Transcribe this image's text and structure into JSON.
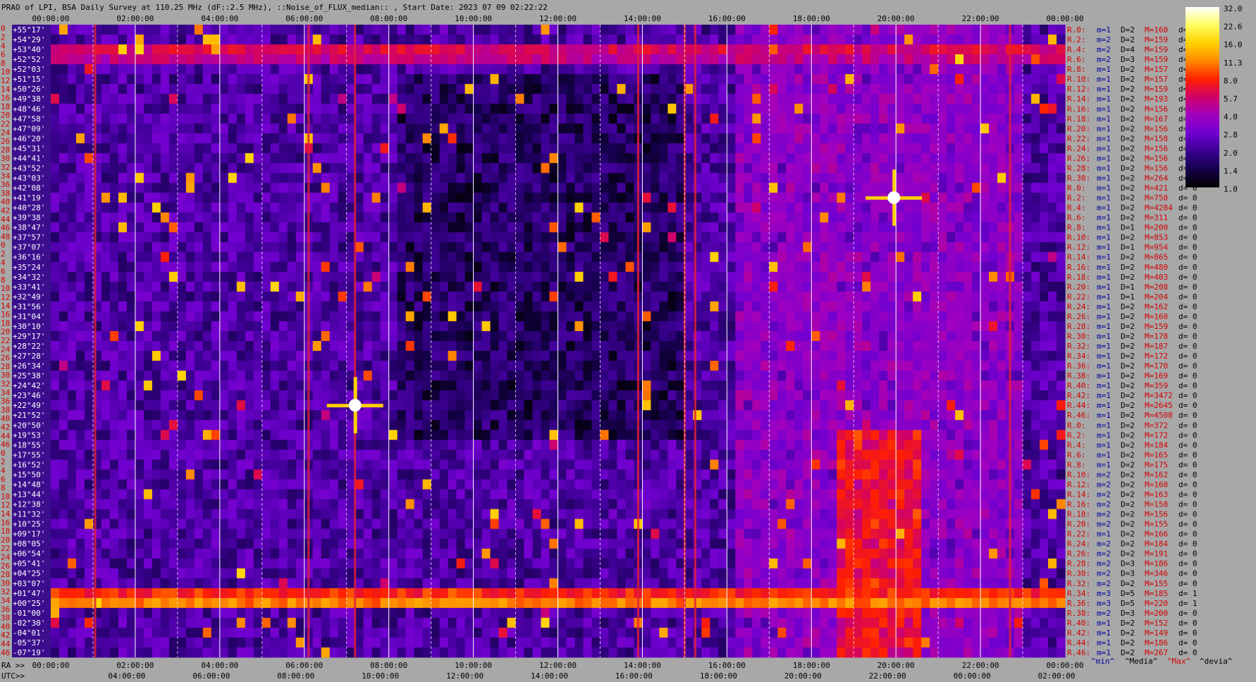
{
  "title": "PRAO of LPI, BSA Daily Survey at 110.25 MHz (dF::2.5 MHz), ::Noise_of_FLUX_median:: , Start Date: 2023 07 09 02:22:22",
  "top_time_labels": [
    "00:00:00",
    "02:00:00",
    "04:00:00",
    "06:00:00",
    "08:00:00",
    "10:00:00",
    "12:00:00",
    "14:00:00",
    "16:00:00",
    "18:00:00",
    "20:00:00",
    "22:00:00",
    "00:00:00"
  ],
  "bottom": {
    "ra_prefix": "RA >>",
    "utc_prefix": "UTC>>",
    "ra_labels": [
      "00:00:00",
      "02:00:00",
      "04:00:00",
      "06:00:00",
      "08:00:00",
      "10:00:00",
      "12:00:00",
      "14:00:00",
      "16:00:00",
      "18:00:00",
      "20:00:00",
      "22:00:00",
      "00:00:00"
    ],
    "utc_labels": [
      "04:00:00",
      "06:00:00",
      "08:00:00",
      "10:00:00",
      "12:00:00",
      "14:00:00",
      "16:00:00",
      "18:00:00",
      "20:00:00",
      "22:00:00",
      "00:00:00",
      "02:00:00"
    ]
  },
  "declinations": [
    "+55°17'",
    "+54°29'",
    "+53°40'",
    "+52°52'",
    "+52°03'",
    "+51°15'",
    "+50°26'",
    "+49°38'",
    "+48°46'",
    "+47°58'",
    "+47°09'",
    "+46°20'",
    "+45°31'",
    "+44°41'",
    "+43°52'",
    "+43°03'",
    "+42°08'",
    "+41°19'",
    "+40°28'",
    "+39°38'",
    "+38°47'",
    "+37°57'",
    "+37°07'",
    "+36°16'",
    "+35°24'",
    "+34°32'",
    "+33°41'",
    "+32°49'",
    "+31°56'",
    "+31°04'",
    "+30°10'",
    "+29°17'",
    "+28°22'",
    "+27°28'",
    "+26°34'",
    "+25°38'",
    "+24°42'",
    "+23°46'",
    "+22°49'",
    "+21°52'",
    "+20°50'",
    "+19°53'",
    "+18°55'",
    "+17°55'",
    "+16°52'",
    "+15°50'",
    "+14°48'",
    "+13°44'",
    "+12°38'",
    "+11°32'",
    "+10°25'",
    "+09°17'",
    "+08°05'",
    "+06°54'",
    "+05°41'",
    "+04°25'",
    "+03°07'",
    "+01°47'",
    "+00°25'",
    "-01°00'",
    "-02°30'",
    "-04°01'",
    "-05°37'",
    "-07°19'"
  ],
  "row_numbers": [
    "0",
    "2",
    "4",
    "6",
    "8",
    "10",
    "12",
    "14",
    "16",
    "18",
    "20",
    "22",
    "24",
    "26",
    "28",
    "30",
    "32",
    "34",
    "36",
    "38",
    "40",
    "42",
    "44",
    "46",
    "48",
    "0",
    "2",
    "4",
    "6",
    "8",
    "10",
    "12",
    "14",
    "16",
    "18",
    "20",
    "22",
    "24",
    "26",
    "28",
    "30",
    "32",
    "34",
    "36",
    "38",
    "40",
    "42",
    "44",
    "46",
    "0",
    "2",
    "4",
    "6",
    "8",
    "10",
    "12",
    "14",
    "16",
    "18",
    "20",
    "22",
    "24",
    "26",
    "28",
    "30",
    "32",
    "34",
    "36",
    "38",
    "40",
    "42",
    "44",
    "46"
  ],
  "stats": [
    {
      "r": "R.0:",
      "m": "m=1",
      "D": "D=2",
      "M": "M=160",
      "d": "d= 0"
    },
    {
      "r": "R.2:",
      "m": "m=2",
      "D": "D=2",
      "M": "M=159",
      "d": "d= 0"
    },
    {
      "r": "R.4:",
      "m": "m=2",
      "D": "D=4",
      "M": "M=159",
      "d": "d= 0"
    },
    {
      "r": "R.6:",
      "m": "m=2",
      "D": "D=3",
      "M": "M=159",
      "d": "d= 0"
    },
    {
      "r": "R.8:",
      "m": "m=1",
      "D": "D=2",
      "M": "M=157",
      "d": "d= 0"
    },
    {
      "r": "R.10:",
      "m": "m=1",
      "D": "D=2",
      "M": "M=157",
      "d": "d="
    },
    {
      "r": "R.12:",
      "m": "m=1",
      "D": "D=2",
      "M": "M=159",
      "d": "d="
    },
    {
      "r": "R.14:",
      "m": "m=1",
      "D": "D=2",
      "M": "M=193",
      "d": "d="
    },
    {
      "r": "R.16:",
      "m": "m=1",
      "D": "D=2",
      "M": "M=156",
      "d": "d="
    },
    {
      "r": "R.18:",
      "m": "m=1",
      "D": "D=2",
      "M": "M=167",
      "d": "d="
    },
    {
      "r": "R.20:",
      "m": "m=1",
      "D": "D=2",
      "M": "M=156",
      "d": "d="
    },
    {
      "r": "R.22:",
      "m": "m=1",
      "D": "D=2",
      "M": "M=158",
      "d": "d="
    },
    {
      "r": "R.24:",
      "m": "m=1",
      "D": "D=2",
      "M": "M=156",
      "d": "d="
    },
    {
      "r": "R.26:",
      "m": "m=1",
      "D": "D=2",
      "M": "M=156",
      "d": "d="
    },
    {
      "r": "R.28:",
      "m": "m=1",
      "D": "D=2",
      "M": "M=156",
      "d": "d="
    },
    {
      "r": "R.30:",
      "m": "m=1",
      "D": "D=2",
      "M": "M=264",
      "d": "d="
    },
    {
      "r": "R.0:",
      "m": "m=1",
      "D": "D=2",
      "M": "M=421",
      "d": "d= 0"
    },
    {
      "r": "R.2:",
      "m": "m=1",
      "D": "D=2",
      "M": "M=750",
      "d": "d= 0"
    },
    {
      "r": "R.4:",
      "m": "m=1",
      "D": "D=2",
      "M": "M=4284",
      "d": "d= 0"
    },
    {
      "r": "R.6:",
      "m": "m=1",
      "D": "D=2",
      "M": "M=311",
      "d": "d= 0"
    },
    {
      "r": "R.8:",
      "m": "m=1",
      "D": "D=1",
      "M": "M=200",
      "d": "d= 0"
    },
    {
      "r": "R.10:",
      "m": "m=1",
      "D": "D=2",
      "M": "M=853",
      "d": "d= 0"
    },
    {
      "r": "R.12:",
      "m": "m=1",
      "D": "D=1",
      "M": "M=954",
      "d": "d= 0"
    },
    {
      "r": "R.14:",
      "m": "m=1",
      "D": "D=2",
      "M": "M=865",
      "d": "d= 0"
    },
    {
      "r": "R.16:",
      "m": "m=1",
      "D": "D=2",
      "M": "M=480",
      "d": "d= 0"
    },
    {
      "r": "R.18:",
      "m": "m=1",
      "D": "D=2",
      "M": "M=403",
      "d": "d= 0"
    },
    {
      "r": "R.20:",
      "m": "m=1",
      "D": "D=1",
      "M": "M=208",
      "d": "d= 0"
    },
    {
      "r": "R.22:",
      "m": "m=1",
      "D": "D=1",
      "M": "M=204",
      "d": "d= 0"
    },
    {
      "r": "R.24:",
      "m": "m=1",
      "D": "D=2",
      "M": "M=162",
      "d": "d= 0"
    },
    {
      "r": "R.26:",
      "m": "m=1",
      "D": "D=2",
      "M": "M=160",
      "d": "d= 0"
    },
    {
      "r": "R.28:",
      "m": "m=1",
      "D": "D=2",
      "M": "M=159",
      "d": "d= 0"
    },
    {
      "r": "R.30:",
      "m": "m=1",
      "D": "D=2",
      "M": "M=178",
      "d": "d= 0"
    },
    {
      "r": "R.32:",
      "m": "m=1",
      "D": "D=2",
      "M": "M=187",
      "d": "d= 0"
    },
    {
      "r": "R.34:",
      "m": "m=1",
      "D": "D=2",
      "M": "M=172",
      "d": "d= 0"
    },
    {
      "r": "R.36:",
      "m": "m=1",
      "D": "D=2",
      "M": "M=170",
      "d": "d= 0"
    },
    {
      "r": "R.38:",
      "m": "m=1",
      "D": "D=2",
      "M": "M=169",
      "d": "d= 0"
    },
    {
      "r": "R.40:",
      "m": "m=1",
      "D": "D=2",
      "M": "M=359",
      "d": "d= 0"
    },
    {
      "r": "R.42:",
      "m": "m=1",
      "D": "D=2",
      "M": "M=3472",
      "d": "d= 0"
    },
    {
      "r": "R.44:",
      "m": "m=1",
      "D": "D=2",
      "M": "M=2645",
      "d": "d= 0"
    },
    {
      "r": "R.46:",
      "m": "m=1",
      "D": "D=2",
      "M": "M=4508",
      "d": "d= 0"
    },
    {
      "r": "R.0:",
      "m": "m=1",
      "D": "D=2",
      "M": "M=372",
      "d": "d= 0"
    },
    {
      "r": "R.2:",
      "m": "m=1",
      "D": "D=2",
      "M": "M=172",
      "d": "d= 0"
    },
    {
      "r": "R.4:",
      "m": "m=1",
      "D": "D=2",
      "M": "M=184",
      "d": "d= 0"
    },
    {
      "r": "R.6:",
      "m": "m=1",
      "D": "D=2",
      "M": "M=165",
      "d": "d= 0"
    },
    {
      "r": "R.8:",
      "m": "m=1",
      "D": "D=2",
      "M": "M=175",
      "d": "d= 0"
    },
    {
      "r": "R.10:",
      "m": "m=2",
      "D": "D=2",
      "M": "M=162",
      "d": "d= 0"
    },
    {
      "r": "R.12:",
      "m": "m=2",
      "D": "D=2",
      "M": "M=160",
      "d": "d= 0"
    },
    {
      "r": "R.14:",
      "m": "m=2",
      "D": "D=2",
      "M": "M=163",
      "d": "d= 0"
    },
    {
      "r": "R.16:",
      "m": "m=2",
      "D": "D=2",
      "M": "M=158",
      "d": "d= 0"
    },
    {
      "r": "R.18:",
      "m": "m=2",
      "D": "D=2",
      "M": "M=156",
      "d": "d= 0"
    },
    {
      "r": "R.20:",
      "m": "m=2",
      "D": "D=2",
      "M": "M=155",
      "d": "d= 0"
    },
    {
      "r": "R.22:",
      "m": "m=1",
      "D": "D=2",
      "M": "M=166",
      "d": "d= 0"
    },
    {
      "r": "R.24:",
      "m": "m=2",
      "D": "D=2",
      "M": "M=184",
      "d": "d= 0"
    },
    {
      "r": "R.26:",
      "m": "m=2",
      "D": "D=2",
      "M": "M=191",
      "d": "d= 0"
    },
    {
      "r": "R.28:",
      "m": "m=2",
      "D": "D=3",
      "M": "M=186",
      "d": "d= 0"
    },
    {
      "r": "R.30:",
      "m": "m=2",
      "D": "D=3",
      "M": "M=346",
      "d": "d= 0"
    },
    {
      "r": "R.32:",
      "m": "m=2",
      "D": "D=2",
      "M": "M=155",
      "d": "d= 0"
    },
    {
      "r": "R.34:",
      "m": "m=3",
      "D": "D=5",
      "M": "M=185",
      "d": "d= 1"
    },
    {
      "r": "R.36:",
      "m": "m=3",
      "D": "D=5",
      "M": "M=220",
      "d": "d= 1"
    },
    {
      "r": "R.38:",
      "m": "m=2",
      "D": "D=3",
      "M": "M=200",
      "d": "d= 0"
    },
    {
      "r": "R.40:",
      "m": "m=1",
      "D": "D=2",
      "M": "M=152",
      "d": "d= 0"
    },
    {
      "r": "R.42:",
      "m": "m=1",
      "D": "D=2",
      "M": "M=149",
      "d": "d= 0"
    },
    {
      "r": "R.44:",
      "m": "m=1",
      "D": "D=2",
      "M": "M=186",
      "d": "d= 0"
    },
    {
      "r": "R.46:",
      "m": "m=1",
      "D": "D=2",
      "M": "M=267",
      "d": "d= 0"
    }
  ],
  "stats_footer": [
    "^min^",
    "^Media^",
    "^Max^",
    "^devia^"
  ],
  "colorbar": {
    "ticks": [
      "32.0",
      "22.6",
      "16.0",
      "11.3",
      "8.0",
      "5.7",
      "4.0",
      "2.8",
      "2.0",
      "1.4",
      "1.0"
    ],
    "colors": [
      "#ffffff",
      "#ffff60",
      "#ffd000",
      "#ff8800",
      "#ff2000",
      "#d0006a",
      "#a000c0",
      "#7000d0",
      "#3a0090",
      "#15004a",
      "#000000"
    ]
  },
  "colors": {
    "background": "#a8a8a8",
    "stat_red": "#d40000",
    "stat_blue": "#0000a0",
    "plot_base": "#3a0e8c"
  },
  "chart_data": {
    "type": "heatmap",
    "title": "PRAO of LPI, BSA Daily Survey at 110.25 MHz (dF::2.5 MHz), ::Noise_of_FLUX_median:: , Start Date: 2023 07 09 02:22:22",
    "x_axis": "RA (hours)",
    "xlim_hours": [
      0,
      24
    ],
    "n_rows": 64,
    "color_scale": "log",
    "color_range": [
      1.0,
      32.0
    ],
    "strong_sources": [
      {
        "ra_hours": 7.2,
        "row": 38,
        "peak": 32
      },
      {
        "ra_hours": 19.95,
        "row": 17,
        "peak": 32
      }
    ],
    "interference_rows": [
      {
        "row": 57,
        "level": 8
      },
      {
        "row": 58,
        "level": 11
      },
      {
        "row": 2,
        "level": 6
      },
      {
        "row": 3,
        "level": 5
      }
    ],
    "vertical_stripes_hours": [
      1.05,
      6.1,
      7.2,
      13.9,
      15.0,
      15.25,
      22.7
    ]
  }
}
